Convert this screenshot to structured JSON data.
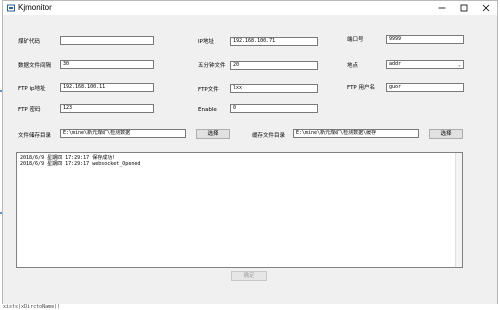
{
  "window": {
    "title": "Kjmonitor"
  },
  "form": {
    "mine_code_label": "煤矿代码",
    "mine_code_value": "",
    "ip_label": "IP地址",
    "ip_value": "192.168.100.71",
    "port_label": "端口号",
    "port_value": "9999",
    "interval_label": "数据文件间隔",
    "interval_value": "30",
    "five_min_label": "五分钟文件",
    "five_min_value": "20",
    "location_label": "地点",
    "location_value": "addr",
    "ftp_ip_label": "FTP ip地址",
    "ftp_ip_value": "192.168.100.11",
    "ftp_file_label": "FTP文件",
    "ftp_file_value": "lxx",
    "ftp_user_label": "FTP 用户名",
    "ftp_user_value": "guor",
    "ftp_pwd_label": "FTP 密码",
    "ftp_pwd_value": "123",
    "enable_label": "Enable",
    "enable_value": "0",
    "storage_dir_label": "文件储存目录",
    "storage_dir_value": "E:\\mine\\新元煤矿\\检测数据",
    "storage_select_label": "选择",
    "cache_dir_label": "缓存文件目录",
    "cache_dir_value": "E:\\mine\\新元煤矿\\检测数据\\缓存",
    "cache_select_label": "选择"
  },
  "log": {
    "lines": [
      "2018/6/9 星期四 17:29:17 保存成功!",
      "2018/6/9 星期四 17:29:17 websocket_Opened"
    ]
  },
  "footer": {
    "confirm_label": "确定"
  },
  "background": {
    "ide_text": "xists(xDirctoName))"
  },
  "colors": {
    "selection": "#3a76d8",
    "window_bg": "#f0f0f0"
  }
}
